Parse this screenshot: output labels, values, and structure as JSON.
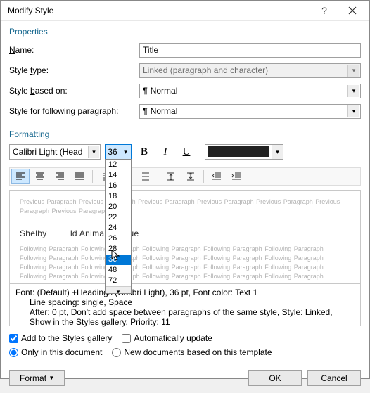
{
  "dialog": {
    "title": "Modify Style"
  },
  "sections": {
    "properties": "Properties",
    "formatting": "Formatting"
  },
  "labels": {
    "name_pre": "",
    "name_ul": "N",
    "name_post": "ame:",
    "type_pre": "Style ",
    "type_ul": "t",
    "type_post": "ype:",
    "based_pre": "Style ",
    "based_ul": "b",
    "based_post": "ased on:",
    "following_pre": "",
    "following_ul": "S",
    "following_post": "tyle for following paragraph:"
  },
  "fields": {
    "name": "Title",
    "type": "Linked (paragraph and character)",
    "based": "Normal",
    "following": "Normal",
    "font": "Calibri Light (Head",
    "size": "36"
  },
  "size_options": [
    "12",
    "14",
    "16",
    "18",
    "20",
    "22",
    "24",
    "26",
    "28",
    "36",
    "48",
    "72"
  ],
  "size_selected": "36",
  "preview": {
    "prev_para": "Previous Paragraph Previous Paragraph Previous Paragraph Previous Paragraph Previous Paragraph Previous Paragraph Previous Paragraph",
    "title_a": "Shelby",
    "title_b": "ld Animal Rescue",
    "following_para": "Following Paragraph Following Paragraph Following Paragraph Following Paragraph Following Paragraph Following Paragraph Following Paragraph Following Paragraph Following Paragraph Following Paragraph Following Paragraph Following Paragraph Following Paragraph Following Paragraph Following Paragraph Following Paragraph Following Paragraph Following Paragraph Following Paragraph Following Paragraph Following Paragraph"
  },
  "description": {
    "l1": "Font: (Default) +Headings (Calibri Light), 36 pt, Font color: Text 1",
    "l2": "Line spacing:  single, Space",
    "l3": "After:  0 pt, Don't add space between paragraphs of the same style, Style: Linked, Show in the Styles gallery, Priority: 11"
  },
  "checks": {
    "gallery_pre": "",
    "gallery_ul": "A",
    "gallery_post": "dd to the Styles gallery",
    "auto_pre": "A",
    "auto_ul": "u",
    "auto_post": "tomatically update",
    "only_doc": "Only in this document",
    "new_docs": "New documents based on this template"
  },
  "buttons": {
    "format_pre": "F",
    "format_ul": "o",
    "format_post": "rmat",
    "ok": "OK",
    "cancel": "Cancel"
  },
  "colors": {
    "text": "#212121"
  }
}
